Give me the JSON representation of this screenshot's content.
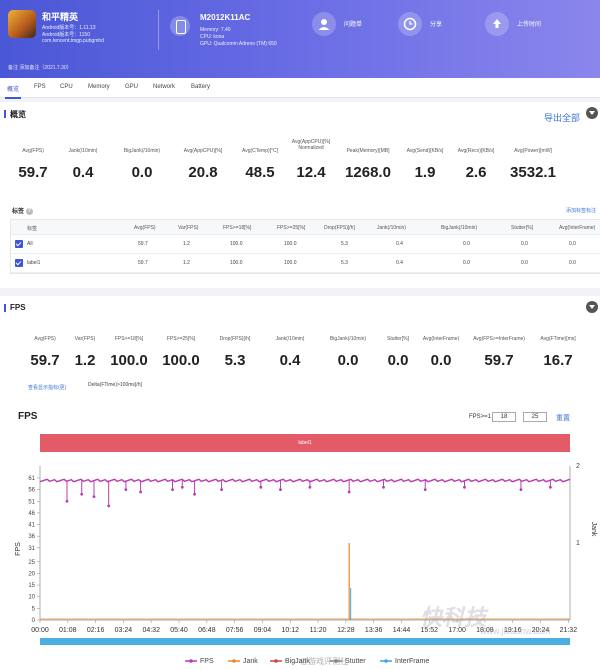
{
  "header": {
    "app_name": "和平精英",
    "app_lines": [
      "Android版本号：1.11.13",
      "Android版本号：1150",
      "com.tencent.tmgp.pubgmhd"
    ],
    "device_model": "M2012K11AC",
    "device_lines": [
      "Memory: 7.40",
      "CPU: kona",
      "GPU: Qualcomm Adreno (TM) 650"
    ],
    "buttons": [
      {
        "label": "问题单",
        "icon": "user-icon"
      },
      {
        "label": "分享",
        "icon": "clock-icon"
      },
      {
        "label": "上传时间",
        "icon": "upload-icon"
      }
    ],
    "note": "备注  添加备注（2021.7.30）"
  },
  "tabs": [
    "概览",
    "FPS",
    "CPU",
    "Memory",
    "GPU",
    "Network",
    "Battery"
  ],
  "overview": {
    "title": "概览",
    "export_label": "导出全部",
    "stats": [
      {
        "label": "Avg(FPS)",
        "value": "59.7"
      },
      {
        "label": "Jank(/10min)",
        "value": "0.4"
      },
      {
        "label": "BigJank(/10min)",
        "value": "0.0"
      },
      {
        "label": "Avg(AppCPU)[%]",
        "value": "20.8"
      },
      {
        "label": "Avg(CTemp)[°C]",
        "value": "48.5"
      },
      {
        "label": "Avg(AppCPU)[%] Normalized",
        "value": "12.4"
      },
      {
        "label": "Peak(Memory)[MB]",
        "value": "1268.0"
      },
      {
        "label": "Avg(Send)[KB/s]",
        "value": "1.9"
      },
      {
        "label": "Avg(Recv)[KB/s]",
        "value": "2.6"
      },
      {
        "label": "Avg(Power)[mW]",
        "value": "3532.1"
      }
    ],
    "tags_label": "标签",
    "tags_link": "添加标签标注",
    "table": {
      "headers": [
        "标签",
        "Avg(FPS)",
        "Var(FPS)",
        "FPS>=18[%]",
        "FPS>=25[%]",
        "Drop(FPS)[/h]",
        "Jank(/10min)",
        "BigJank(/10min)",
        "Stutter[%]",
        "Avg(InterFrame)"
      ],
      "rows": [
        [
          "All",
          "59.7",
          "1.2",
          "100.0",
          "100.0",
          "5.3",
          "0.4",
          "0.0",
          "0.0",
          "0.0"
        ],
        [
          "label1",
          "59.7",
          "1.2",
          "100.0",
          "100.0",
          "5.3",
          "0.4",
          "0.0",
          "0.0",
          "0.0"
        ]
      ]
    }
  },
  "fps_section": {
    "title": "FPS",
    "stats": [
      {
        "label": "Avg(FPS)",
        "value": "59.7"
      },
      {
        "label": "Var(FPS)",
        "value": "1.2"
      },
      {
        "label": "FPS>=18[%]",
        "value": "100.0"
      },
      {
        "label": "FPS>=25[%]",
        "value": "100.0"
      },
      {
        "label": "Drop(FPS)[/h]",
        "value": "5.3"
      },
      {
        "label": "Jank(/10min)",
        "value": "0.4"
      },
      {
        "label": "BigJank(/10min)",
        "value": "0.0"
      },
      {
        "label": "Stutter[%]",
        "value": "0.0"
      },
      {
        "label": "Avg(InterFrame)",
        "value": "0.0"
      },
      {
        "label": "Avg(FPS>=InterFrame)",
        "value": "59.7"
      },
      {
        "label": "Avg(FTime)[ms]",
        "value": "16.7"
      }
    ],
    "more_link": "查看显示指标(更)",
    "delta_text": "Delta(FTime)>100ms[/h]",
    "chart_title": "FPS",
    "fps_filter_label": "FPS>=1",
    "fps_filter_a": "18",
    "fps_filter_b": "25",
    "reset_label": "重置",
    "band_label": "label1"
  },
  "watermark": {
    "brand": "快科技",
    "url": "www.jixuanw.com",
    "weibo": "@游戏评测社"
  },
  "colors": {
    "accent": "#3d55d8",
    "fps_line": "#b93bb4",
    "jank": "#e48a2b",
    "band": "#e45b68",
    "interframe": "#3aa6e0"
  },
  "chart_data": {
    "type": "line",
    "title": "FPS",
    "xlabel": "",
    "ylabel": "FPS",
    "y2label": "Jank",
    "ylim": [
      0,
      61
    ],
    "y2lim": [
      0,
      2
    ],
    "yticks": [
      0,
      5,
      10,
      15,
      20,
      25,
      31,
      36,
      41,
      46,
      51,
      56,
      61
    ],
    "y2ticks": [
      1,
      2
    ],
    "xticks": [
      "00:00",
      "01:08",
      "02:16",
      "03:24",
      "04:32",
      "05:40",
      "06:48",
      "07:56",
      "09:04",
      "10:12",
      "11:20",
      "12:28",
      "13:36",
      "14:44",
      "15:52",
      "17:00",
      "18:08",
      "19:16",
      "20:24",
      "21:32"
    ],
    "duration_min": 21.6,
    "series": [
      {
        "name": "FPS",
        "type": "line",
        "approx_value": 60,
        "dips": [
          {
            "t": 1.1,
            "v": 51
          },
          {
            "t": 1.7,
            "v": 54
          },
          {
            "t": 2.2,
            "v": 53
          },
          {
            "t": 2.8,
            "v": 49
          },
          {
            "t": 3.5,
            "v": 56
          },
          {
            "t": 4.1,
            "v": 55
          },
          {
            "t": 5.4,
            "v": 56
          },
          {
            "t": 5.8,
            "v": 57
          },
          {
            "t": 6.3,
            "v": 54
          },
          {
            "t": 7.4,
            "v": 56
          },
          {
            "t": 9.0,
            "v": 57
          },
          {
            "t": 9.8,
            "v": 56
          },
          {
            "t": 11.0,
            "v": 57
          },
          {
            "t": 12.6,
            "v": 55
          },
          {
            "t": 14.0,
            "v": 57
          },
          {
            "t": 15.7,
            "v": 56
          },
          {
            "t": 17.3,
            "v": 57
          },
          {
            "t": 19.6,
            "v": 56
          },
          {
            "t": 20.8,
            "v": 57
          }
        ]
      },
      {
        "name": "Jank",
        "type": "spike",
        "axis": "y2",
        "events": [
          {
            "t": 12.6,
            "v": 1
          }
        ]
      },
      {
        "name": "BigJank",
        "type": "line",
        "values": [
          0
        ]
      },
      {
        "name": "Stutter",
        "type": "line",
        "values": [
          0
        ]
      },
      {
        "name": "InterFrame",
        "type": "line",
        "values": [
          0
        ]
      }
    ],
    "legend": "bottom"
  }
}
